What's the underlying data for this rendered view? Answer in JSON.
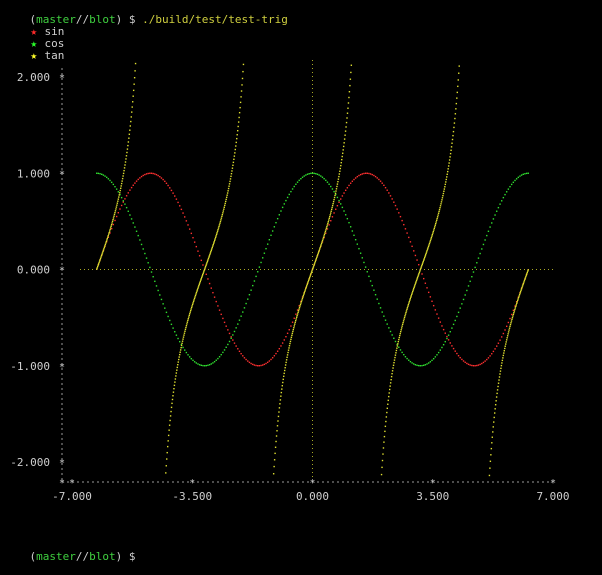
{
  "terminal": {
    "prompt_open": "(",
    "branch": "master",
    "prompt_mid": "//",
    "dir": "blot",
    "prompt_close": ")",
    "dollar": " $ ",
    "command": "./build/test/test-trig",
    "final_prompt_cursor": ""
  },
  "legend": [
    {
      "label": "sin",
      "color": "#ff2a2a",
      "star": "★"
    },
    {
      "label": "cos",
      "color": "#2aff2a",
      "star": "★"
    },
    {
      "label": "tan",
      "color": "#ffff2a",
      "star": "★"
    }
  ],
  "chart_data": {
    "type": "scatter",
    "title": "",
    "xlabel": "",
    "ylabel": "",
    "xlim": [
      -7.0,
      7.0
    ],
    "ylim": [
      -2.2,
      2.2
    ],
    "x_ticks": [
      "-7.000",
      "-3.500",
      "0.000",
      "3.500",
      "7.000"
    ],
    "y_ticks": [
      "2.000",
      "1.000",
      "0.000",
      "-1.000",
      "-2.000"
    ],
    "x_tick_values": [
      -7.0,
      -3.5,
      0.0,
      3.5,
      7.0
    ],
    "y_tick_values": [
      2.0,
      1.0,
      0.0,
      -1.0,
      -2.0
    ],
    "grid": false,
    "series": [
      {
        "name": "sin",
        "function": "sin",
        "color": "#ff3030",
        "x_range": [
          -6.28,
          6.28
        ]
      },
      {
        "name": "cos",
        "function": "cos",
        "color": "#30e030",
        "x_range": [
          -6.28,
          6.28
        ]
      },
      {
        "name": "tan",
        "function": "tan",
        "color": "#e0e030",
        "x_range": [
          -6.28,
          6.28
        ]
      }
    ],
    "zero_lines": {
      "color": "#e0e030"
    }
  }
}
